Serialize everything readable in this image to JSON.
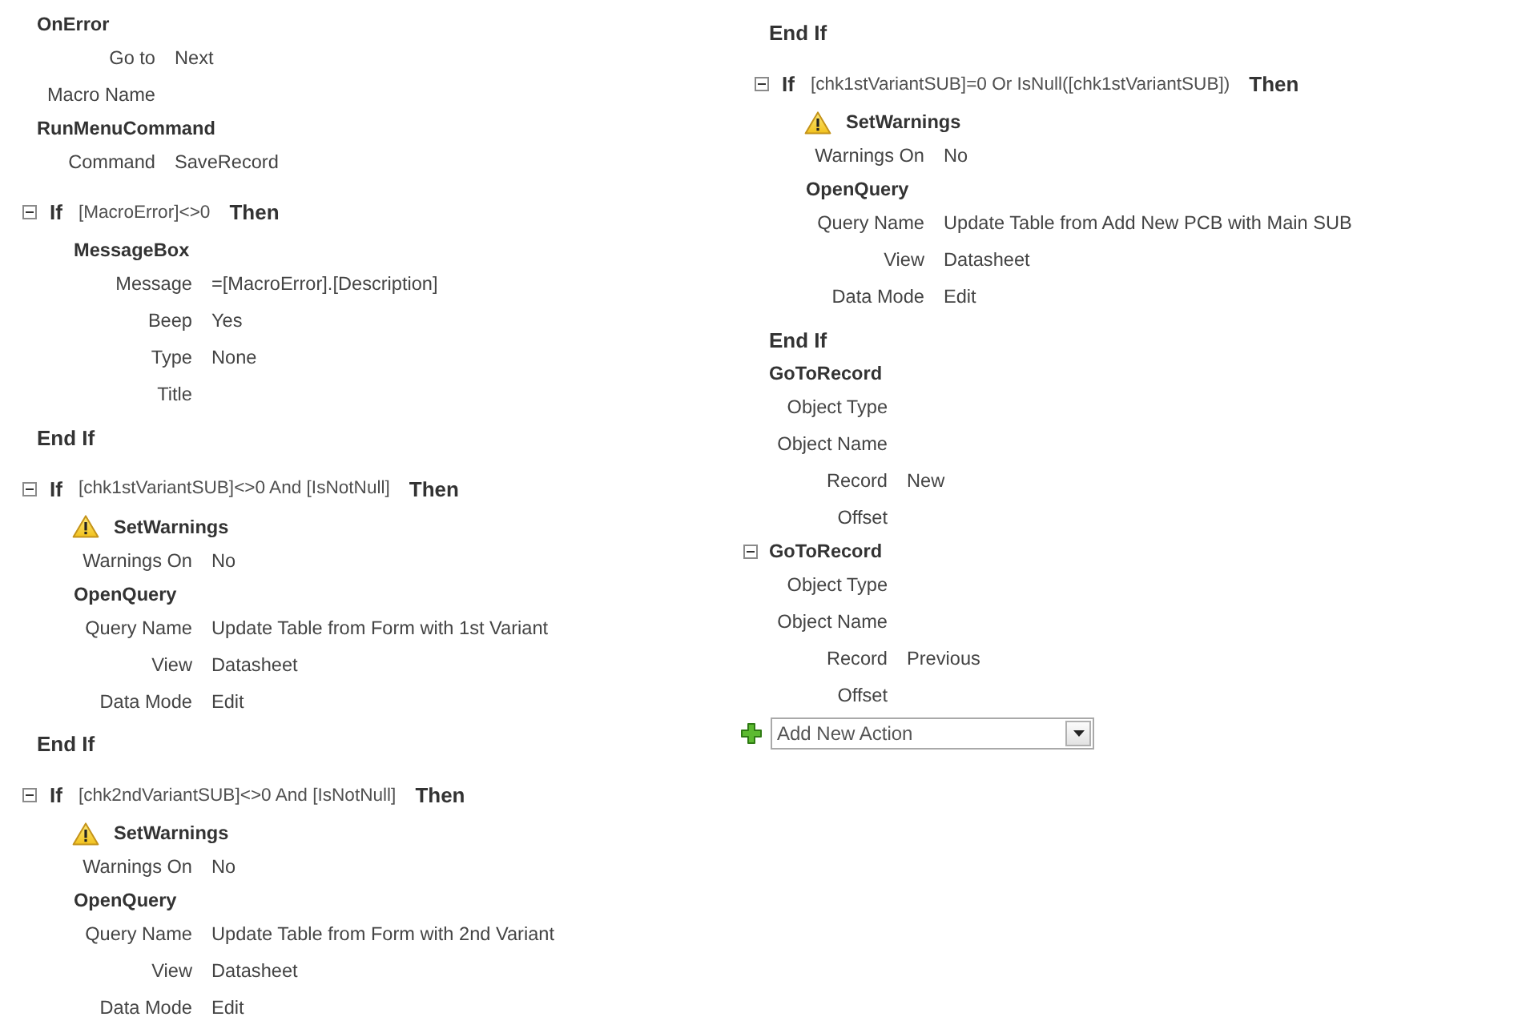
{
  "columns": [
    {
      "items": [
        {
          "kind": "action",
          "name": "OnError",
          "warning": false,
          "hovered": false,
          "expanded": true,
          "arguments": [
            {
              "label": "Go to",
              "value": "Next"
            },
            {
              "label": "Macro Name"
            }
          ]
        },
        {
          "kind": "action",
          "name": "RunMenuCommand",
          "warning": false,
          "hovered": false,
          "expanded": true,
          "arguments": [
            {
              "label": "Command",
              "value": "SaveRecord"
            }
          ]
        },
        {
          "kind": "if",
          "keyword": "If",
          "condition": "[MacroError]<>0",
          "then": "Then",
          "expanded": true,
          "children": [
            {
              "kind": "action",
              "name": "MessageBox",
              "warning": false,
              "hovered": false,
              "expanded": true,
              "arguments": [
                {
                  "label": "Message",
                  "value": "=[MacroError].[Description]"
                },
                {
                  "label": "Beep",
                  "value": "Yes"
                },
                {
                  "label": "Type",
                  "value": "None"
                },
                {
                  "label": "Title"
                }
              ]
            }
          ],
          "end": "End If"
        },
        {
          "kind": "if",
          "keyword": "If",
          "condition": "[chk1stVariantSUB]<>0 And [IsNotNull]",
          "then": "Then",
          "expanded": true,
          "children": [
            {
              "kind": "action",
              "name": "SetWarnings",
              "warning": true,
              "hovered": false,
              "expanded": true,
              "arguments": [
                {
                  "label": "Warnings On",
                  "value": "No"
                }
              ]
            },
            {
              "kind": "action",
              "name": "OpenQuery",
              "warning": false,
              "hovered": false,
              "expanded": true,
              "arguments": [
                {
                  "label": "Query Name",
                  "value": "Update Table from Form with 1st Variant"
                },
                {
                  "label": "View",
                  "value": "Datasheet"
                },
                {
                  "label": "Data Mode",
                  "value": "Edit"
                }
              ]
            }
          ],
          "end": "End If"
        },
        {
          "kind": "if",
          "keyword": "If",
          "condition": "[chk2ndVariantSUB]<>0 And [IsNotNull]",
          "then": "Then",
          "expanded": true,
          "children": [
            {
              "kind": "action",
              "name": "SetWarnings",
              "warning": true,
              "hovered": false,
              "expanded": true,
              "arguments": [
                {
                  "label": "Warnings On",
                  "value": "No"
                }
              ]
            },
            {
              "kind": "action",
              "name": "OpenQuery",
              "warning": false,
              "hovered": false,
              "expanded": true,
              "arguments": [
                {
                  "label": "Query Name",
                  "value": "Update Table from Form with 2nd Variant"
                },
                {
                  "label": "View",
                  "value": "Datasheet"
                },
                {
                  "label": "Data Mode",
                  "value": "Edit"
                }
              ]
            }
          ]
        }
      ]
    },
    {
      "items": [
        {
          "kind": "end_if",
          "text": "End If"
        },
        {
          "kind": "if",
          "keyword": "If",
          "condition": "[chk1stVariantSUB]=0 Or IsNull([chk1stVariantSUB])",
          "then": "Then",
          "expanded": true,
          "children": [
            {
              "kind": "action",
              "name": "SetWarnings",
              "warning": true,
              "hovered": false,
              "expanded": true,
              "arguments": [
                {
                  "label": "Warnings On",
                  "value": "No"
                }
              ]
            },
            {
              "kind": "action",
              "name": "OpenQuery",
              "warning": false,
              "hovered": false,
              "expanded": true,
              "arguments": [
                {
                  "label": "Query Name",
                  "value": "Update Table from Add New PCB with Main SUB"
                },
                {
                  "label": "View",
                  "value": "Datasheet"
                },
                {
                  "label": "Data Mode",
                  "value": "Edit"
                }
              ]
            }
          ],
          "end": "End If"
        },
        {
          "kind": "action",
          "name": "GoToRecord",
          "warning": false,
          "hovered": false,
          "expanded": true,
          "arguments": [
            {
              "label": "Object Type"
            },
            {
              "label": "Object Name"
            },
            {
              "label": "Record",
              "value": "New"
            },
            {
              "label": "Offset"
            }
          ]
        },
        {
          "kind": "action",
          "name": "GoToRecord",
          "warning": false,
          "hovered": true,
          "expanded": true,
          "arguments": [
            {
              "label": "Object Type"
            },
            {
              "label": "Object Name"
            },
            {
              "label": "Record",
              "value": "Previous"
            },
            {
              "label": "Offset"
            }
          ]
        },
        {
          "kind": "add_action",
          "placeholder": "Add New Action"
        }
      ]
    }
  ]
}
